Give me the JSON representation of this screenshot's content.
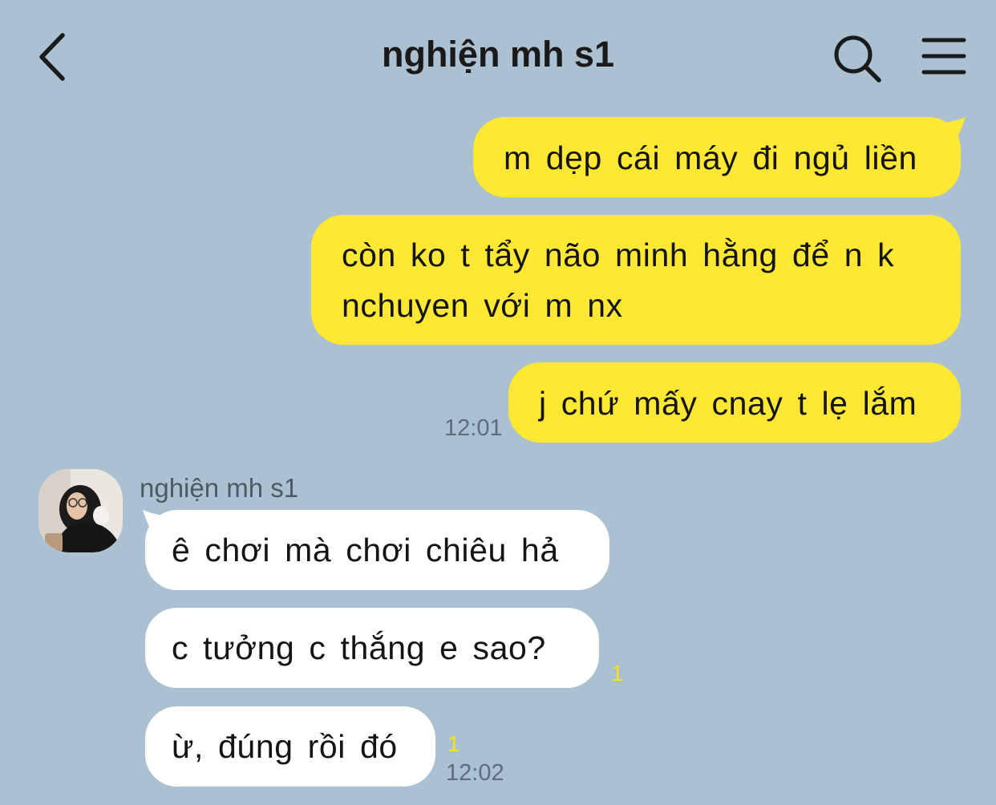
{
  "header": {
    "title": "nghiện mh s1",
    "back_icon": "chevron-left-icon",
    "search_icon": "search-icon",
    "menu_icon": "hamburger-menu-icon"
  },
  "colors": {
    "background": "#abc1d1",
    "my_bubble": "#fee833",
    "their_bubble": "#ffffff",
    "unread": "#f6e21a"
  },
  "messages": {
    "sent": [
      {
        "text": "m dẹp cái máy đi ngủ liền"
      },
      {
        "lines": [
          "còn ko t tẩy não minh hằng để n k",
          "nchuyen với m nx"
        ]
      },
      {
        "text": "j chứ mấy cnay t lẹ lắm"
      }
    ],
    "sent_time": "12:01",
    "sender_name": "nghiện mh s1",
    "received": [
      {
        "text": "ê chơi mà chơi chiêu hả"
      },
      {
        "text": "c tưởng c thắng e sao?",
        "unread": "1"
      },
      {
        "text": "ừ, đúng rồi đó",
        "unread": "1",
        "time": "12:02"
      }
    ]
  }
}
